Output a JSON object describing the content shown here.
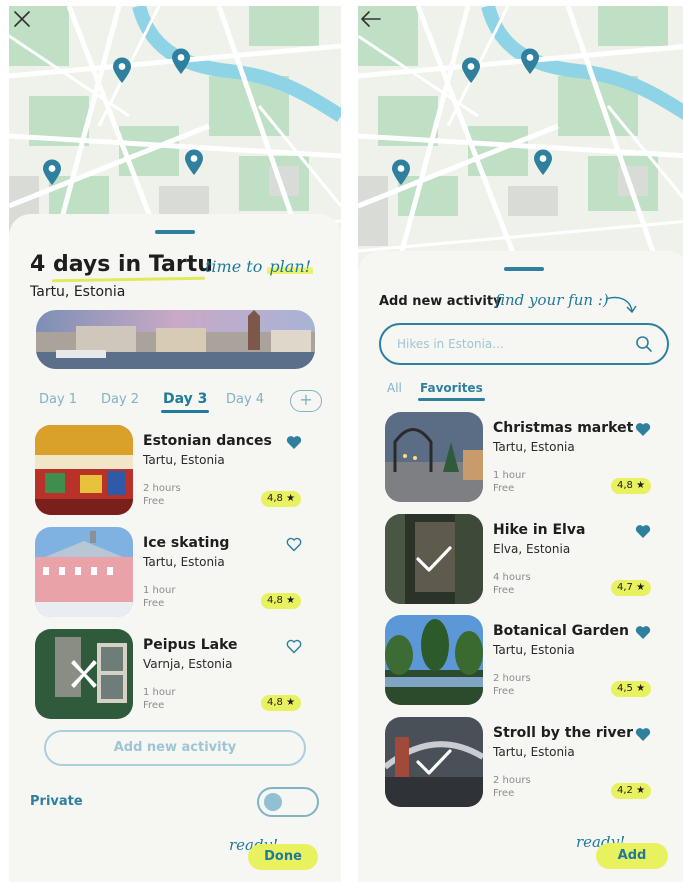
{
  "left": {
    "trip_title": "4 days in Tartu",
    "tagline": "time to plan!",
    "tagline_prefix": "time to ",
    "tagline_highlight": "plan!",
    "location": "Tartu, Estonia",
    "days": [
      "Day 1",
      "Day 2",
      "Day 3",
      "Day 4"
    ],
    "active_day": "Day 3",
    "add_day_icon": "+",
    "activities": [
      {
        "title": "Estonian dances",
        "place": "Tartu, Estonia",
        "duration": "2 hours",
        "price": "Free",
        "rating": "4,8",
        "favorite": true
      },
      {
        "title": "Ice skating",
        "place": "Tartu, Estonia",
        "duration": "1 hour",
        "price": "Free",
        "rating": "4,8",
        "favorite": false
      },
      {
        "title": "Peipus Lake",
        "place": "Varnja, Estonia",
        "duration": "1 hour",
        "price": "Free",
        "rating": "4,8",
        "favorite": false
      }
    ],
    "add_activity_label": "Add new activity",
    "private_label": "Private",
    "ready_text": "ready!",
    "done_label": "Done"
  },
  "right": {
    "title": "Add new activity",
    "tagline": "find your fun :)",
    "search_placeholder": "Hikes in Estonia...",
    "tabs": [
      "All",
      "Favorites"
    ],
    "active_tab": "Favorites",
    "activities": [
      {
        "title": "Christmas market",
        "place": "Tartu, Estonia",
        "duration": "1 hour",
        "price": "Free",
        "rating": "4,8",
        "favorite": true,
        "selected": false
      },
      {
        "title": "Hike in Elva",
        "place": "Elva, Estonia",
        "duration": "4 hours",
        "price": "Free",
        "rating": "4,7",
        "favorite": true,
        "selected": true
      },
      {
        "title": "Botanical Garden",
        "place": "Tartu, Estonia",
        "duration": "2 hours",
        "price": "Free",
        "rating": "4,5",
        "favorite": true,
        "selected": false
      },
      {
        "title": "Stroll by the river",
        "place": "Tartu, Estonia",
        "duration": "2 hours",
        "price": "Free",
        "rating": "4,2",
        "favorite": true,
        "selected": true
      }
    ],
    "ready_text": "ready!",
    "add_label": "Add"
  },
  "icons": {
    "close": "close-icon",
    "back": "arrow-left-icon",
    "pin": "map-pin-icon",
    "heart": "heart-icon",
    "star": "star-icon",
    "search": "search-icon",
    "check": "check-icon",
    "remove": "x-icon"
  },
  "colors": {
    "primary": "#1f7a9c",
    "accent": "#e8f15e",
    "river": "#8fd3e6",
    "park": "#bfe0c4"
  }
}
